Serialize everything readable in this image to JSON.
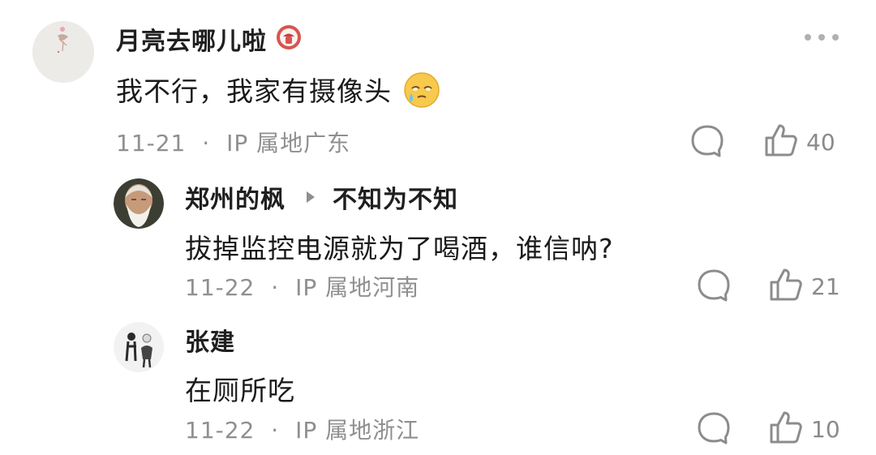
{
  "comments": [
    {
      "author": "月亮去哪儿啦",
      "text": "我不行，我家有摄像头",
      "date": "11-21",
      "location": "IP 属地广东",
      "likes": "40"
    },
    {
      "author": "郑州的枫",
      "reply_to": "不知为不知",
      "text": "拔掉监控电源就为了喝酒，谁信呐?",
      "date": "11-22",
      "location": "IP 属地河南",
      "likes": "21"
    },
    {
      "author": "张建",
      "text": "在厕所吃",
      "date": "11-22",
      "location": "IP 属地浙江",
      "likes": "10"
    }
  ],
  "meta_separator": "·",
  "icons": {
    "badge": "red-badge-icon",
    "emoji": "crying-face-emoji-icon",
    "reply_arrow": "triangle-right-icon",
    "comment": "comment-bubble-icon",
    "like": "thumbs-up-icon",
    "more": "more-dots-icon"
  },
  "colors": {
    "text": "#1a1a1a",
    "meta": "#8f8f8f",
    "badge": "#d9534f"
  }
}
